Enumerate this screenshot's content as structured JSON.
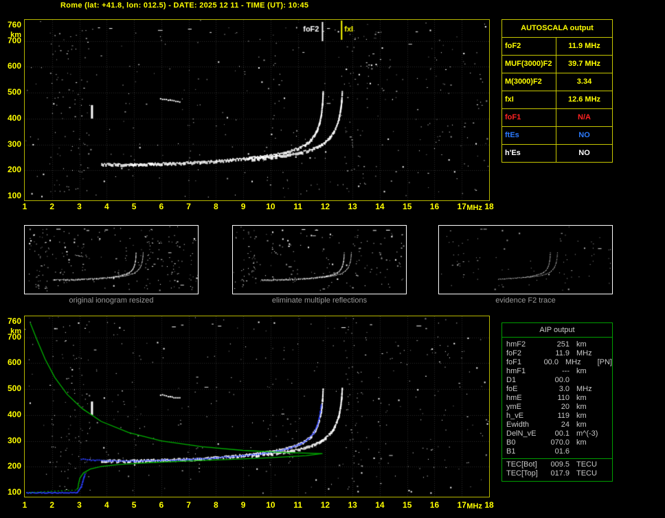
{
  "header": {
    "title": "Rome (lat: +41.8, lon: 012.5) - DATE: 2025 12 11 - TIME (UT): 10:45"
  },
  "colors": {
    "background": "#000000",
    "title_text": "#ffff00",
    "axis_text": "#ffff00",
    "plot_border": "#b8b800",
    "grid": "#2e2e2e",
    "trace_white": "#ffffff",
    "restored_trace_blue": "#2b3fff",
    "profile_green": "#00b400",
    "autoscala_border": "#c8c800",
    "foF1_red": "#ff2222",
    "ftEs_blue": "#2b7bff",
    "aip_border": "#00a000",
    "aip_text": "#c9c9c9",
    "caption_text": "#9a9a9a",
    "thumb_border": "#ffffff"
  },
  "autoscala": {
    "header": "AUTOSCALA output",
    "rows": [
      {
        "label": "foF2",
        "value": "11.9 MHz",
        "color": "#ffff00"
      },
      {
        "label": "MUF(3000)F2",
        "value": "39.7 MHz",
        "color": "#ffff00"
      },
      {
        "label": "M(3000)F2",
        "value": "3.34",
        "color": "#ffff00"
      },
      {
        "label": "fxI",
        "value": "12.6 MHz",
        "color": "#ffff00"
      },
      {
        "label": "foF1",
        "value": "N/A",
        "color": "#ff2222"
      },
      {
        "label": "ftEs",
        "value": "NO",
        "color": "#2b7bff"
      },
      {
        "label": "h'Es",
        "value": "NO",
        "color": "#ffffff"
      }
    ]
  },
  "aip": {
    "header": "AIP output",
    "rows": [
      {
        "label": "hmF2",
        "value": "251",
        "unit": "km",
        "extra": ""
      },
      {
        "label": "foF2",
        "value": "11.9",
        "unit": "MHz",
        "extra": ""
      },
      {
        "label": "foF1",
        "value": "00.0",
        "unit": "MHz",
        "extra": "[PN]"
      },
      {
        "label": "hmF1",
        "value": "---",
        "unit": "km",
        "extra": ""
      },
      {
        "label": "D1",
        "value": "00.0",
        "unit": "",
        "extra": ""
      },
      {
        "label": "foE",
        "value": "3.0",
        "unit": "MHz",
        "extra": ""
      },
      {
        "label": "hmE",
        "value": "110",
        "unit": "km",
        "extra": ""
      },
      {
        "label": "ymE",
        "value": "20",
        "unit": "km",
        "extra": ""
      },
      {
        "label": "h_vE",
        "value": "119",
        "unit": "km",
        "extra": ""
      },
      {
        "label": "Ewidth",
        "value": "24",
        "unit": "km",
        "extra": ""
      },
      {
        "label": "DelN_vE",
        "value": "00.1",
        "unit": "m^(-3)",
        "extra": ""
      },
      {
        "label": "B0",
        "value": "070.0",
        "unit": "km",
        "extra": ""
      },
      {
        "label": "B1",
        "value": "01.6",
        "unit": "",
        "extra": ""
      }
    ],
    "tec_rows": [
      {
        "label": "TEC[Bot]",
        "value": "009.5",
        "unit": "TECU"
      },
      {
        "label": "TEC[Top]",
        "value": "017.9",
        "unit": "TECU"
      }
    ]
  },
  "thumbnails": [
    {
      "caption": "original ionogram resized"
    },
    {
      "caption": "eliminate multiple reflections"
    },
    {
      "caption": "evidence F2 trace"
    }
  ],
  "chart_data": [
    {
      "name": "scaled-ionogram",
      "type": "scatter",
      "xlabel": "MHz",
      "ylabel": "km",
      "xlim": [
        1,
        18
      ],
      "ylim": [
        100,
        760
      ],
      "xticks": [
        1,
        2,
        3,
        4,
        5,
        6,
        7,
        8,
        9,
        10,
        11,
        12,
        13,
        14,
        15,
        16,
        17,
        18
      ],
      "yticks": [
        100,
        200,
        300,
        400,
        500,
        600,
        700,
        760
      ],
      "grid": true,
      "o_trace_f_km": [
        [
          3.8,
          227
        ],
        [
          4.4,
          226
        ],
        [
          5.0,
          226
        ],
        [
          5.6,
          228
        ],
        [
          6.2,
          230
        ],
        [
          6.8,
          232
        ],
        [
          7.4,
          235
        ],
        [
          8.0,
          239
        ],
        [
          8.6,
          244
        ],
        [
          9.2,
          250
        ],
        [
          9.7,
          257
        ],
        [
          10.2,
          265
        ],
        [
          10.6,
          275
        ],
        [
          11.0,
          289
        ],
        [
          11.25,
          303
        ],
        [
          11.45,
          320
        ],
        [
          11.6,
          341
        ],
        [
          11.7,
          363
        ],
        [
          11.78,
          390
        ],
        [
          11.84,
          422
        ],
        [
          11.88,
          460
        ],
        [
          11.9,
          505
        ]
      ],
      "x_trace_f_km": [
        [
          9.3,
          247
        ],
        [
          10.0,
          253
        ],
        [
          10.6,
          262
        ],
        [
          11.1,
          272
        ],
        [
          11.5,
          285
        ],
        [
          11.8,
          300
        ],
        [
          12.0,
          315
        ],
        [
          12.15,
          331
        ],
        [
          12.3,
          352
        ],
        [
          12.4,
          375
        ],
        [
          12.48,
          402
        ],
        [
          12.54,
          435
        ],
        [
          12.58,
          470
        ],
        [
          12.6,
          505
        ]
      ],
      "second_hop_echo_f_km": [
        [
          5.95,
          480
        ],
        [
          6.3,
          473
        ],
        [
          6.65,
          467
        ]
      ],
      "interference_bar": {
        "f": 3.45,
        "km": [
          400,
          452
        ]
      },
      "markers": [
        {
          "label": "foF2",
          "f": 11.9,
          "color": "#ffffff"
        },
        {
          "label": "fxI",
          "f": 12.6,
          "color": "#ffff00"
        }
      ]
    },
    {
      "name": "ionogram-with-restored-trace-and-profile",
      "type": "scatter",
      "xlabel": "MHz",
      "ylabel": "km",
      "xlim": [
        1,
        18
      ],
      "ylim": [
        100,
        760
      ],
      "xticks": [
        1,
        2,
        3,
        4,
        5,
        6,
        7,
        8,
        9,
        10,
        11,
        12,
        13,
        14,
        15,
        16,
        17,
        18
      ],
      "yticks": [
        100,
        200,
        300,
        400,
        500,
        600,
        700,
        760
      ],
      "grid": true,
      "o_trace_f_km": [
        [
          3.8,
          227
        ],
        [
          4.4,
          226
        ],
        [
          5.0,
          226
        ],
        [
          5.6,
          228
        ],
        [
          6.2,
          230
        ],
        [
          6.8,
          232
        ],
        [
          7.4,
          235
        ],
        [
          8.0,
          239
        ],
        [
          8.6,
          244
        ],
        [
          9.2,
          250
        ],
        [
          9.7,
          257
        ],
        [
          10.2,
          265
        ],
        [
          10.6,
          275
        ],
        [
          11.0,
          289
        ],
        [
          11.25,
          303
        ],
        [
          11.45,
          320
        ],
        [
          11.6,
          341
        ],
        [
          11.7,
          363
        ],
        [
          11.78,
          390
        ],
        [
          11.84,
          422
        ],
        [
          11.88,
          460
        ],
        [
          11.9,
          505
        ]
      ],
      "x_trace_f_km": [
        [
          9.3,
          247
        ],
        [
          10.0,
          253
        ],
        [
          10.6,
          262
        ],
        [
          11.1,
          272
        ],
        [
          11.5,
          285
        ],
        [
          11.8,
          300
        ],
        [
          12.0,
          315
        ],
        [
          12.15,
          331
        ],
        [
          12.3,
          352
        ],
        [
          12.4,
          375
        ],
        [
          12.48,
          402
        ],
        [
          12.54,
          435
        ],
        [
          12.58,
          470
        ],
        [
          12.6,
          505
        ]
      ],
      "second_hop_echo_f_km": [
        [
          5.95,
          480
        ],
        [
          6.3,
          473
        ],
        [
          6.65,
          467
        ]
      ],
      "interference_bar": {
        "f": 3.45,
        "km": [
          400,
          452
        ]
      },
      "restored_trace_blue_f_km": [
        [
          3.1,
          234
        ],
        [
          3.6,
          230
        ],
        [
          4.2,
          228
        ],
        [
          5.0,
          227
        ],
        [
          6.0,
          230
        ],
        [
          7.0,
          233
        ],
        [
          8.0,
          239
        ],
        [
          9.0,
          247
        ],
        [
          9.7,
          256
        ],
        [
          10.2,
          264
        ],
        [
          10.7,
          276
        ],
        [
          11.1,
          291
        ],
        [
          11.4,
          311
        ],
        [
          11.6,
          334
        ],
        [
          11.72,
          360
        ],
        [
          11.8,
          390
        ],
        [
          11.85,
          420
        ],
        [
          11.88,
          445
        ]
      ],
      "es_trace_blue_f_km": [
        [
          1.05,
          102
        ],
        [
          2.9,
          102
        ],
        [
          3.05,
          126
        ],
        [
          3.18,
          174
        ]
      ],
      "electron_density_profile_green_f_km": [
        [
          1.2,
          756
        ],
        [
          1.45,
          690
        ],
        [
          1.75,
          615
        ],
        [
          2.1,
          545
        ],
        [
          2.55,
          480
        ],
        [
          3.1,
          425
        ],
        [
          3.8,
          375
        ],
        [
          4.8,
          332
        ],
        [
          6.0,
          300
        ],
        [
          7.5,
          277
        ],
        [
          9.0,
          263
        ],
        [
          10.5,
          255
        ],
        [
          11.9,
          251
        ],
        [
          11.3,
          243
        ],
        [
          10.0,
          235
        ],
        [
          8.5,
          228
        ],
        [
          7.0,
          222
        ],
        [
          5.6,
          216
        ],
        [
          4.5,
          209
        ],
        [
          3.8,
          201
        ],
        [
          3.4,
          191
        ],
        [
          3.15,
          176
        ],
        [
          3.02,
          156
        ],
        [
          2.97,
          135
        ],
        [
          2.95,
          118
        ],
        [
          2.9,
          112
        ]
      ],
      "profile_dotted_tail_f_km": [
        [
          2.88,
          110
        ],
        [
          1.1,
          100
        ]
      ]
    }
  ]
}
